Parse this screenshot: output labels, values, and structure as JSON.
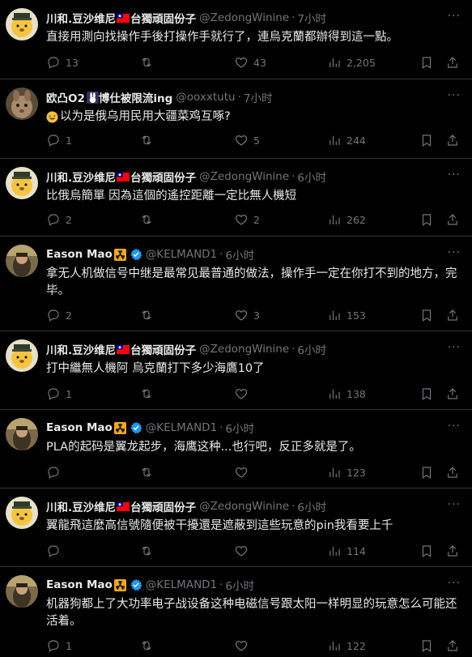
{
  "tweets": [
    {
      "name": "川和.豆沙维尼",
      "name_suffix": "台獨頑固份子",
      "handle": "@ZedongWinine",
      "time": "7小时",
      "text": "直接用測向找操作手後打操作手就行了，連烏克蘭都辦得到這一點。",
      "replies": "13",
      "retweets": "",
      "likes": "43",
      "views": "2,205"
    },
    {
      "name": "欧凸O2",
      "name_suffix": "博仕被限流ing",
      "handle": "@ooxxtutu",
      "time": "7小时",
      "text": "以为是俄乌用民用大疆菜鸡互啄?",
      "replies": "1",
      "retweets": "",
      "likes": "5",
      "views": "244"
    },
    {
      "name": "川和.豆沙维尼",
      "name_suffix": "台獨頑固份子",
      "handle": "@ZedongWinine",
      "time": "6小时",
      "text": "比俄烏簡單 因為這個的遙控距離一定比無人機短",
      "replies": "2",
      "retweets": "",
      "likes": "2",
      "views": "262"
    },
    {
      "name": "Eason Mao",
      "name_suffix": "",
      "handle": "@KELMAND1",
      "time": "6小时",
      "text": "拿无人机做信号中继是最常见最普通的做法，操作手一定在你打不到的地方，完毕。",
      "replies": "2",
      "retweets": "",
      "likes": "3",
      "views": "153"
    },
    {
      "name": "川和.豆沙维尼",
      "name_suffix": "台獨頑固份子",
      "handle": "@ZedongWinine",
      "time": "6小时",
      "text": "打中繼無人機阿 烏克蘭打下多少海鷹10了",
      "replies": "1",
      "retweets": "",
      "likes": "",
      "views": "138"
    },
    {
      "name": "Eason Mao",
      "name_suffix": "",
      "handle": "@KELMAND1",
      "time": "6小时",
      "text": "PLA的起码是翼龙起步，海鹰这种...也行吧，反正多就是了。",
      "replies": "",
      "retweets": "",
      "likes": "",
      "views": "123"
    },
    {
      "name": "川和.豆沙维尼",
      "name_suffix": "台獨頑固份子",
      "handle": "@ZedongWinine",
      "time": "6小时",
      "text": "翼龍飛這麼高信號隨便被干擾還是遮蔽到這些玩意的pin我看要上千",
      "replies": "",
      "retweets": "",
      "likes": "",
      "views": "114"
    },
    {
      "name": "Eason Mao",
      "name_suffix": "",
      "handle": "@KELMAND1",
      "time": "6小时",
      "text": "机器狗都上了大功率电子战设备这种电磁信号跟太阳一样明显的玩意怎么可能还活着。",
      "replies": "1",
      "retweets": "",
      "likes": "",
      "views": "122"
    }
  ],
  "icons": {
    "reply": "reply-icon",
    "retweet": "retweet-icon",
    "like": "heart-icon",
    "views": "views-icon",
    "bookmark": "bookmark-icon",
    "share": "share-icon",
    "verified": "verified-badge-icon",
    "radioactive": "radioactive-icon",
    "flag": "flag-icon"
  },
  "colors": {
    "background": "#000000",
    "text": "#e7e9ea",
    "muted": "#71767b",
    "divider": "#2f3336",
    "verified": "#1d9bf0"
  }
}
